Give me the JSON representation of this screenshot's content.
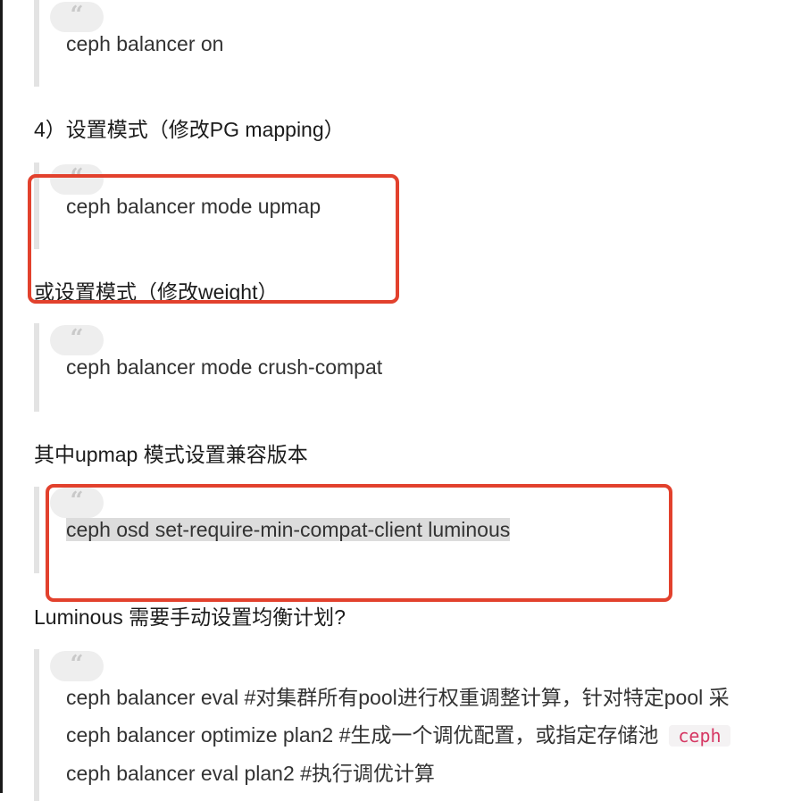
{
  "blocks": {
    "b1": {
      "lines": [
        "ceph balancer on"
      ]
    },
    "h1": "4）设置模式（修改PG mapping）",
    "b2": {
      "lines": [
        "ceph balancer mode upmap"
      ]
    },
    "h2": "或设置模式（修改weight）",
    "b3": {
      "lines": [
        "ceph balancer mode crush-compat"
      ]
    },
    "h3": "其中upmap 模式设置兼容版本",
    "b4": {
      "lines": [
        "ceph osd set-require-min-compat-client luminous"
      ]
    },
    "h4": "Luminous 需要手动设置均衡计划?",
    "b5": {
      "lines": [
        "ceph balancer eval #对集群所有pool进行权重调整计算，针对特定pool 采",
        "ceph balancer optimize plan2 #生成一个调优配置，或指定存储池",
        "ceph balancer eval plan2 #执行调优计算"
      ],
      "code_chip": "ceph"
    }
  },
  "quote_icon": "quote-icon",
  "colors": {
    "highlight_box": "#e2412d",
    "code_text": "#d63864",
    "quote_border": "#e3e3e3"
  }
}
